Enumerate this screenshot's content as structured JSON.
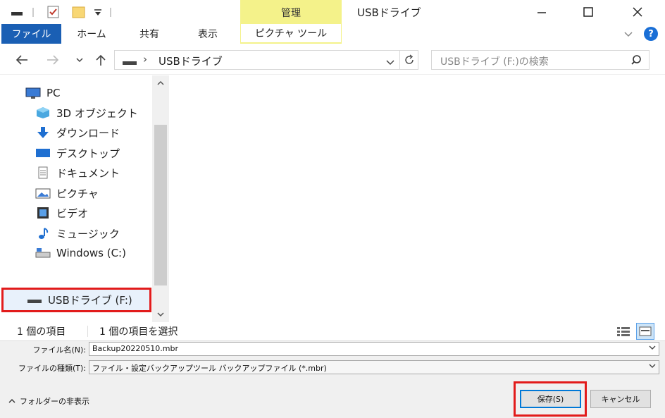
{
  "window": {
    "title": "USBドライブ",
    "context_group_label": "管理",
    "buttons": {
      "minimize": "—",
      "maximize": "☐",
      "close": "✕"
    }
  },
  "ribbon": {
    "tabs": [
      {
        "label": "ファイル"
      },
      {
        "label": "ホーム"
      },
      {
        "label": "共有"
      },
      {
        "label": "表示"
      },
      {
        "label": "ピクチャ ツール"
      }
    ],
    "help_icon": "?"
  },
  "address": {
    "path_label": "USBドライブ",
    "search_placeholder": "USBドライブ (F:)の検索"
  },
  "nav": {
    "items": [
      {
        "label": "PC",
        "icon": "pc-icon"
      },
      {
        "label": "3D オブジェクト",
        "icon": "3d-objects-icon"
      },
      {
        "label": "ダウンロード",
        "icon": "download-icon"
      },
      {
        "label": "デスクトップ",
        "icon": "desktop-icon"
      },
      {
        "label": "ドキュメント",
        "icon": "document-icon"
      },
      {
        "label": "ピクチャ",
        "icon": "pictures-icon"
      },
      {
        "label": "ビデオ",
        "icon": "video-icon"
      },
      {
        "label": "ミュージック",
        "icon": "music-icon"
      },
      {
        "label": "Windows (C:)",
        "icon": "drive-icon"
      },
      {
        "label": "USBドライブ (F:)",
        "icon": "usb-drive-icon",
        "selected": true
      }
    ]
  },
  "status": {
    "item_count": "1 個の項目",
    "selected_count": "1 個の項目を選択"
  },
  "save_dialog": {
    "filename_label": "ファイル名(N):",
    "filename_value": "Backup20220510.mbr",
    "filetype_label": "ファイルの種類(T):",
    "filetype_value": "ファイル・設定バックアップツール バックアップファイル (*.mbr)",
    "hide_folders_label": "フォルダーの非表示",
    "save_button": "保存(S)",
    "cancel_button": "キャンセル"
  },
  "colors": {
    "accent_blue": "#1a5fb4",
    "context_yellow": "#f4f28a",
    "highlight_red": "#e21b1b"
  }
}
